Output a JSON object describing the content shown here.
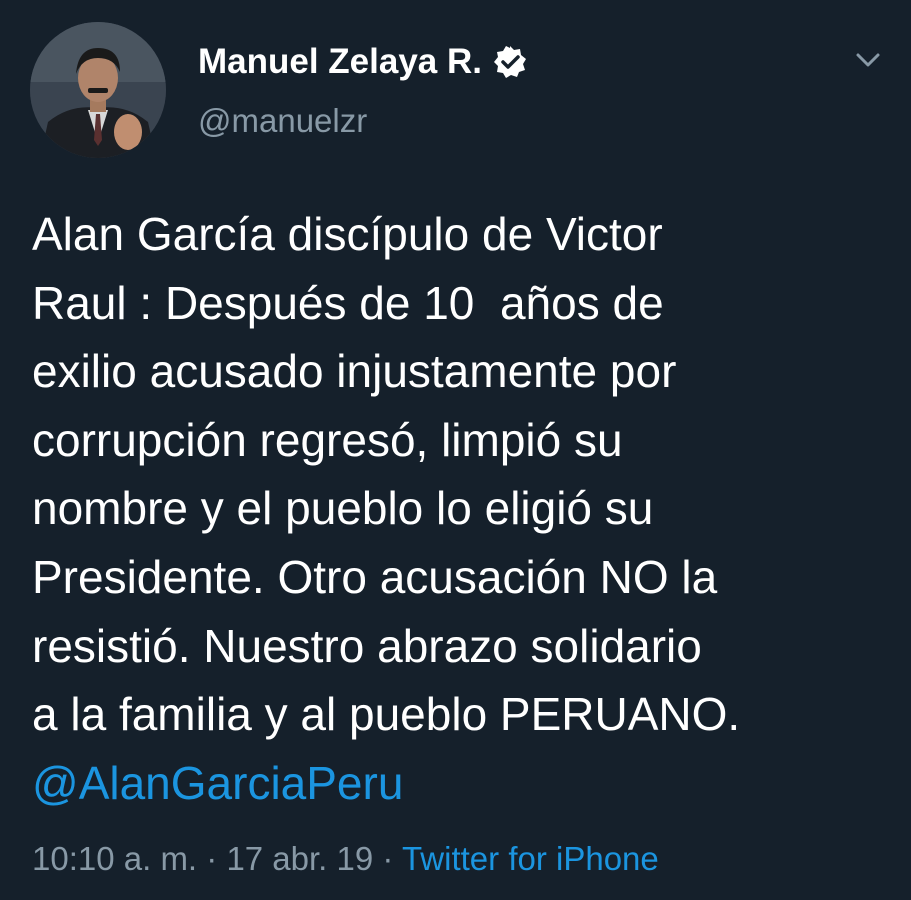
{
  "colors": {
    "background": "#15202b",
    "text": "#ffffff",
    "secondary_text": "#8899a6",
    "link": "#1b95e0"
  },
  "author": {
    "display_name": "Manuel Zelaya R.",
    "handle": "@manuelzr",
    "verified": true,
    "verified_icon": "verified-badge-icon",
    "avatar": "profile-photo-avatar"
  },
  "menu": {
    "icon": "chevron-down-icon"
  },
  "tweet": {
    "lines": [
      "Alan García discípulo de Victor",
      "Raul : Después de 10  años de",
      "exilio acusado injustamente por",
      "corrupción regresó, limpió su",
      "nombre y el pueblo lo eligió su",
      "Presidente. Otro acusación NO la",
      "resistió. Nuestro abrazo solidario",
      "a la familia y al pueblo PERUANO."
    ],
    "mention": "@AlanGarciaPeru"
  },
  "meta": {
    "time": "10:10 a. m.",
    "separator": " · ",
    "date": "17 abr. 19",
    "source": "Twitter for iPhone"
  }
}
